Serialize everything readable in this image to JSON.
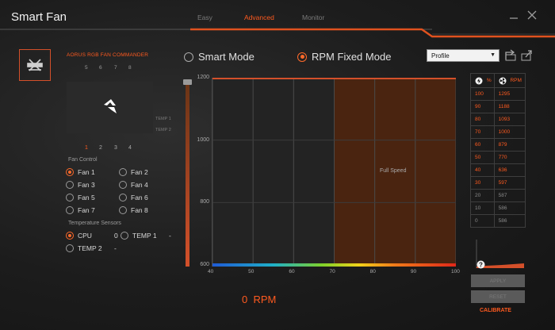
{
  "window": {
    "title": "Smart Fan"
  },
  "nav": {
    "tabs": [
      "Easy",
      "Advanced",
      "Monitor"
    ],
    "active": 1
  },
  "commander": {
    "title": "AORUS RGB FAN COMMANDER",
    "top_ports": [
      "5",
      "6",
      "7",
      "8"
    ],
    "temp_labels": [
      "TEMP 1",
      "TEMP 2"
    ],
    "bottom_ports": [
      "1",
      "2",
      "3",
      "4"
    ],
    "active_port": 0
  },
  "fan_control": {
    "label": "Fan Control",
    "fans": [
      {
        "label": "Fan 1",
        "selected": true
      },
      {
        "label": "Fan 2",
        "selected": false
      },
      {
        "label": "Fan 3",
        "selected": false
      },
      {
        "label": "Fan 4",
        "selected": false
      },
      {
        "label": "Fan 5",
        "selected": false
      },
      {
        "label": "Fan 6",
        "selected": false
      },
      {
        "label": "Fan 7",
        "selected": false
      },
      {
        "label": "Fan 8",
        "selected": false
      }
    ]
  },
  "temp_sensors": {
    "label": "Temperature Sensors",
    "items": [
      {
        "label": "CPU",
        "value": "0",
        "selected": true
      },
      {
        "label": "TEMP 1",
        "value": "-",
        "selected": false
      },
      {
        "label": "TEMP 2",
        "value": "-",
        "selected": false
      }
    ]
  },
  "modes": {
    "smart": "Smart Mode",
    "rpm_fixed": "RPM Fixed Mode",
    "active": "rpm_fixed"
  },
  "profile": {
    "value": "Profile"
  },
  "chart_data": {
    "type": "area",
    "y_ticks": [
      "1200",
      "1000",
      "800",
      "600"
    ],
    "x_ticks": [
      "40",
      "50",
      "60",
      "70",
      "80",
      "90",
      "100"
    ],
    "ylim": [
      600,
      1200
    ],
    "xlim": [
      40,
      100
    ],
    "full_speed_region": [
      70,
      100
    ],
    "annotation": "Full Speed"
  },
  "rpm_readout": {
    "value": "0",
    "unit": "RPM"
  },
  "rpm_table": {
    "headers": [
      "%",
      "RPM"
    ],
    "rows": [
      {
        "pct": "100",
        "rpm": "1295",
        "active": true
      },
      {
        "pct": "90",
        "rpm": "1188",
        "active": true
      },
      {
        "pct": "80",
        "rpm": "1093",
        "active": true
      },
      {
        "pct": "70",
        "rpm": "1000",
        "active": true
      },
      {
        "pct": "60",
        "rpm": "879",
        "active": true
      },
      {
        "pct": "50",
        "rpm": "770",
        "active": true
      },
      {
        "pct": "40",
        "rpm": "636",
        "active": true
      },
      {
        "pct": "30",
        "rpm": "597",
        "active": true
      },
      {
        "pct": "20",
        "rpm": "587",
        "active": false
      },
      {
        "pct": "10",
        "rpm": "586",
        "active": false
      },
      {
        "pct": "0",
        "rpm": "586",
        "active": false
      }
    ]
  },
  "calibrate": {
    "label": "CALIBRATE",
    "button1": "APPLY",
    "button2": "RESET"
  },
  "colors": {
    "accent": "#ff5a1f",
    "full_speed_fill": "#4a2410"
  }
}
